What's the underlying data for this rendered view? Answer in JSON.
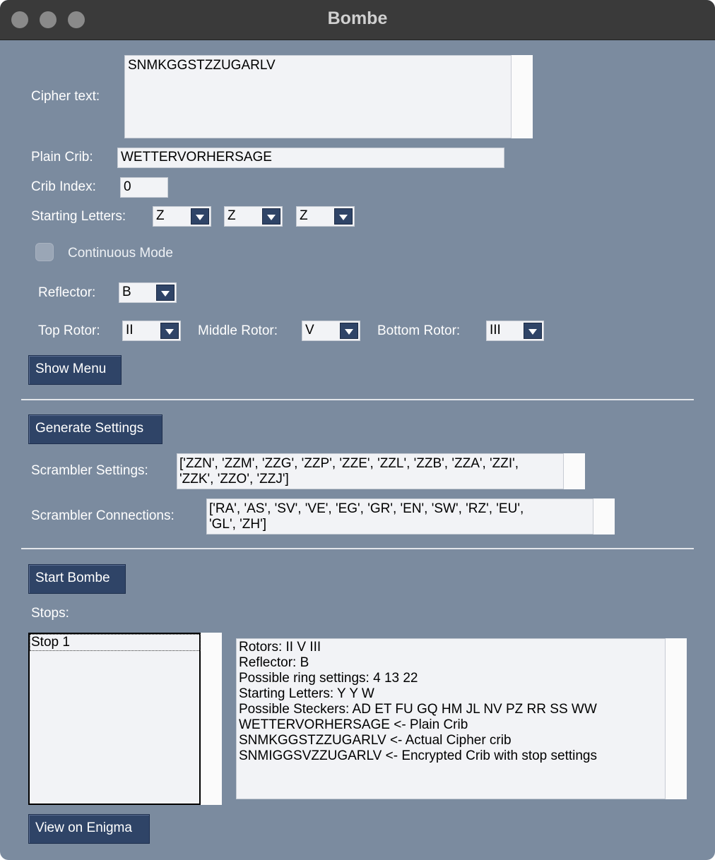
{
  "window": {
    "title": "Bombe"
  },
  "cipher": {
    "label": "Cipher text:",
    "value": "SNMKGGSTZZUGARLV"
  },
  "crib": {
    "label": "Plain Crib:",
    "value": "WETTERVORHERSAGE"
  },
  "crib_index": {
    "label": "Crib Index:",
    "value": "0"
  },
  "starting": {
    "label": "Starting Letters:",
    "letters": [
      "Z",
      "Z",
      "Z"
    ]
  },
  "continuous": {
    "label": "Continuous Mode"
  },
  "reflector": {
    "label": "Reflector:",
    "value": "B"
  },
  "rotors": {
    "top_label": "Top Rotor:",
    "top_value": "II",
    "middle_label": "Middle Rotor:",
    "middle_value": "V",
    "bottom_label": "Bottom Rotor:",
    "bottom_value": "III"
  },
  "buttons": {
    "show_menu": "Show Menu",
    "generate": "Generate Settings",
    "start": "Start Bombe",
    "view": "View on Enigma"
  },
  "scrambler_settings": {
    "label": "Scrambler Settings:",
    "lines": [
      "['ZZN', 'ZZM', 'ZZG', 'ZZP', 'ZZE', 'ZZL', 'ZZB', 'ZZA', 'ZZI',",
      "'ZZK', 'ZZO', 'ZZJ']"
    ]
  },
  "scrambler_connections": {
    "label": "Scrambler Connections:",
    "lines": [
      "['RA', 'AS', 'SV', 'VE', 'EG', 'GR', 'EN', 'SW', 'RZ', 'EU',",
      "'GL', 'ZH']"
    ]
  },
  "stops": {
    "label": "Stops:",
    "items": [
      "Stop 1"
    ]
  },
  "stop_info": {
    "lines": [
      "Rotors: II V III",
      "Reflector: B",
      "Possible ring settings: 4 13 22",
      "Starting Letters: Y Y W",
      "Possible Steckers: AD ET FU GQ HM JL NV PZ RR SS WW",
      "WETTERVORHERSAGE <- Plain Crib",
      "SNMKGGSTZZUGARLV <- Actual Cipher crib",
      "SNMIGGSVZZUGARLV <- Encrypted Crib with stop settings"
    ]
  },
  "colors": {
    "background": "#7b8b9f",
    "button": "#2f4467",
    "titlebar": "#3a3a3a"
  }
}
